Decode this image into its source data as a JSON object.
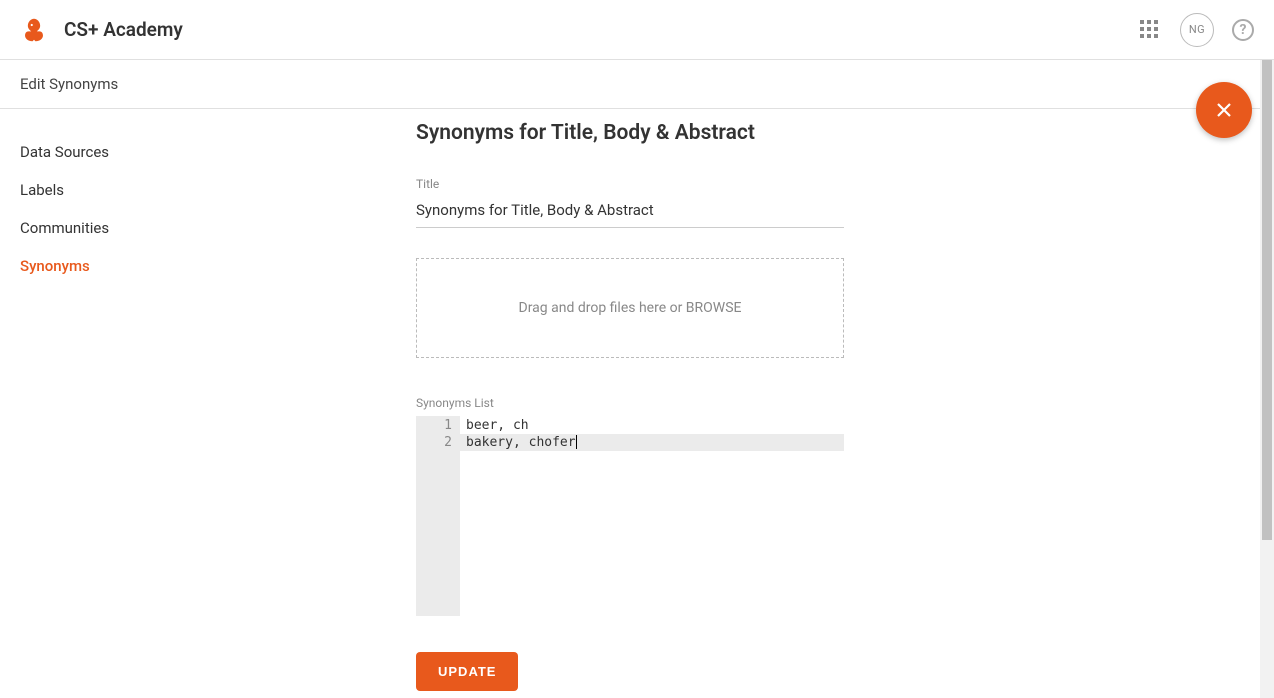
{
  "header": {
    "app_name": "CS+ Academy",
    "avatar_initials": "NG"
  },
  "subheader": {
    "title": "Edit Synonyms"
  },
  "sidebar": {
    "items": [
      {
        "label": "Data Sources",
        "active": false
      },
      {
        "label": "Labels",
        "active": false
      },
      {
        "label": "Communities",
        "active": false
      },
      {
        "label": "Synonyms",
        "active": true
      }
    ]
  },
  "page": {
    "title": "Synonyms for Title, Body & Abstract",
    "title_field_label": "Title",
    "title_field_value": "Synonyms for Title, Body & Abstract",
    "dropzone_text": "Drag and drop files here or BROWSE",
    "list_label": "Synonyms List",
    "editor_lines": [
      {
        "num": "1",
        "text": "beer, ch",
        "active": false
      },
      {
        "num": "2",
        "text": "bakery, chofer",
        "active": true
      }
    ],
    "update_button": "UPDATE"
  }
}
